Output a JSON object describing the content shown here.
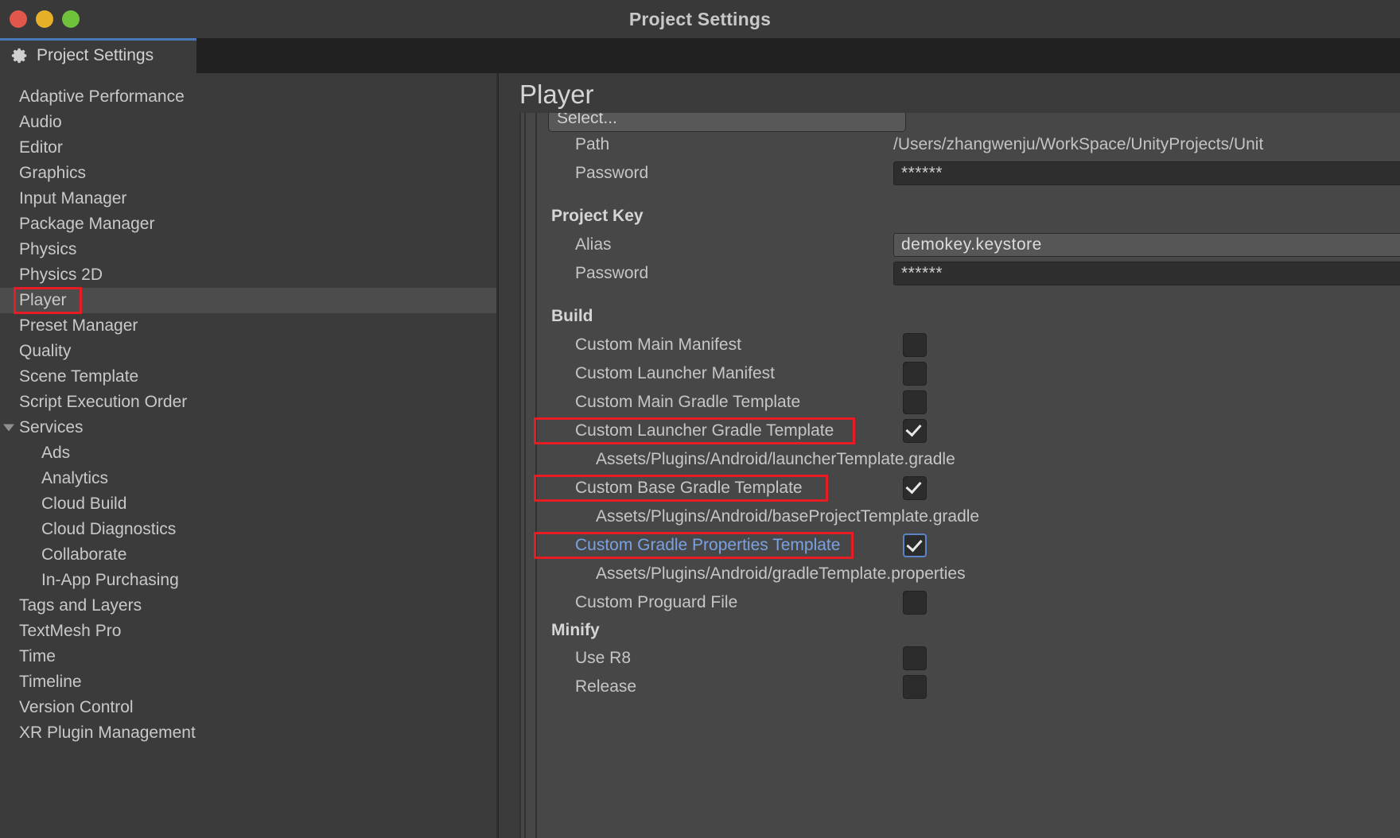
{
  "window": {
    "title": "Project Settings",
    "traffic_lights": [
      "close-red",
      "minimize-yellow",
      "zoom-green"
    ]
  },
  "tab": {
    "label": "Project Settings",
    "icon": "gear-icon"
  },
  "sidebar": {
    "items": [
      {
        "label": "Adaptive Performance",
        "level": 0,
        "selected": false
      },
      {
        "label": "Audio",
        "level": 0,
        "selected": false
      },
      {
        "label": "Editor",
        "level": 0,
        "selected": false
      },
      {
        "label": "Graphics",
        "level": 0,
        "selected": false
      },
      {
        "label": "Input Manager",
        "level": 0,
        "selected": false
      },
      {
        "label": "Package Manager",
        "level": 0,
        "selected": false
      },
      {
        "label": "Physics",
        "level": 0,
        "selected": false
      },
      {
        "label": "Physics 2D",
        "level": 0,
        "selected": false
      },
      {
        "label": "Player",
        "level": 0,
        "selected": true,
        "highlighted": true
      },
      {
        "label": "Preset Manager",
        "level": 0,
        "selected": false
      },
      {
        "label": "Quality",
        "level": 0,
        "selected": false
      },
      {
        "label": "Scene Template",
        "level": 0,
        "selected": false
      },
      {
        "label": "Script Execution Order",
        "level": 0,
        "selected": false
      },
      {
        "label": "Services",
        "level": 0,
        "selected": false,
        "expanded": true
      },
      {
        "label": "Ads",
        "level": 1,
        "selected": false
      },
      {
        "label": "Analytics",
        "level": 1,
        "selected": false
      },
      {
        "label": "Cloud Build",
        "level": 1,
        "selected": false
      },
      {
        "label": "Cloud Diagnostics",
        "level": 1,
        "selected": false
      },
      {
        "label": "Collaborate",
        "level": 1,
        "selected": false
      },
      {
        "label": "In-App Purchasing",
        "level": 1,
        "selected": false
      },
      {
        "label": "Tags and Layers",
        "level": 0,
        "selected": false
      },
      {
        "label": "TextMesh Pro",
        "level": 0,
        "selected": false
      },
      {
        "label": "Time",
        "level": 0,
        "selected": false
      },
      {
        "label": "Timeline",
        "level": 0,
        "selected": false
      },
      {
        "label": "Version Control",
        "level": 0,
        "selected": false
      },
      {
        "label": "XR Plugin Management",
        "level": 0,
        "selected": false
      }
    ]
  },
  "main": {
    "title": "Player",
    "select_button": "Select...",
    "rows": {
      "path_label": "Path",
      "path_value": "/Users/zhangwenju/WorkSpace/UnityProjects/Unit",
      "password_label": "Password",
      "password_value": "******",
      "project_key_head": "Project Key",
      "alias_label": "Alias",
      "alias_value": "demokey.keystore",
      "key_password_label": "Password",
      "key_password_value": "******",
      "build_head": "Build",
      "custom_main_manifest": "Custom Main Manifest",
      "custom_launcher_manifest": "Custom Launcher Manifest",
      "custom_main_gradle": "Custom Main Gradle Template",
      "custom_launcher_gradle": "Custom Launcher Gradle Template",
      "launcher_gradle_path": "Assets/Plugins/Android/launcherTemplate.gradle",
      "custom_base_gradle": "Custom Base Gradle Template",
      "base_gradle_path": "Assets/Plugins/Android/baseProjectTemplate.gradle",
      "custom_gradle_properties": "Custom Gradle Properties Template",
      "gradle_properties_path": "Assets/Plugins/Android/gradleTemplate.properties",
      "custom_proguard": "Custom Proguard File",
      "minify_head": "Minify",
      "use_r8": "Use R8",
      "release": "Release"
    },
    "checkbox_states": {
      "custom_main_manifest": false,
      "custom_launcher_manifest": false,
      "custom_main_gradle": false,
      "custom_launcher_gradle": true,
      "custom_base_gradle": true,
      "custom_gradle_properties": true,
      "custom_proguard": false,
      "use_r8": false,
      "release": false
    }
  },
  "colors": {
    "annotation_red": "#e81c24",
    "accent_blue": "#7aa2e3",
    "tab_underline": "#4a79b8",
    "panel_bg": "#474747",
    "sidebar_bg": "#3b3b3b"
  }
}
